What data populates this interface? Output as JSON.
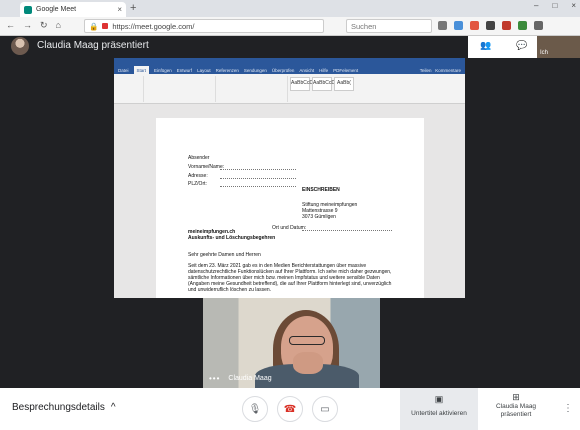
{
  "browser": {
    "tab_title": "Google Meet",
    "url": "https://meet.google.com/",
    "search_placeholder": "Suchen"
  },
  "meet": {
    "presenter_title": "Claudia Maag präsentiert",
    "self_label": "Ich",
    "webcam_name": "Claudia Maag",
    "details_label": "Besprechungsdetails",
    "subtitles_label": "Untertitel aktivieren",
    "present_label": "Claudia Maag präsentiert",
    "colors": {
      "hangup": "#d93025",
      "meet_bg": "#202124"
    }
  },
  "word": {
    "tabs": [
      "Datei",
      "Start",
      "Einfügen",
      "Entwurf",
      "Layout",
      "Referenzen",
      "Sendungen",
      "Überprüfen",
      "Ansicht",
      "Hilfe",
      "PDFelement"
    ],
    "share_label": "Teilen",
    "comments_label": "Kommentare",
    "styles": [
      "AaBbCcDc",
      "AaBbCcDc",
      "AaBb("
    ],
    "doc": {
      "absender": "Absender",
      "vorname": "Vorname/Name:",
      "adresse": "Adresse:",
      "plz": "PLZ/Ort:",
      "einschreiben": "EINSCHREIBEN",
      "recipient": [
        "Stiftung meineimpfungen",
        "Mattenstrasse 9",
        "3073 Gümligen"
      ],
      "ort_datum": "Ort und Datum:",
      "subject_1": "meineimpfungen.ch",
      "subject_2": "Auskunfts- und Löschungsbegehren",
      "salutation": "Sehr geehrte Damen und Herren",
      "body": [
        "Seit dem 23. März 2021 gab es in den Medien Berichterstattungen über massive",
        "datenschutzrechtliche Funktionslücken auf Ihrer Plattform. Ich sehe mich daher gezwungen,",
        "sämtliche Informationen über mich bzw. meinen Impfstatus und weitere sensible Daten",
        "(Angaben meine Gesundheit betreffend), die auf Ihrer Plattform hinterlegt sind, unverzüglich",
        "und unwiderruflich löschen zu lassen."
      ]
    }
  }
}
